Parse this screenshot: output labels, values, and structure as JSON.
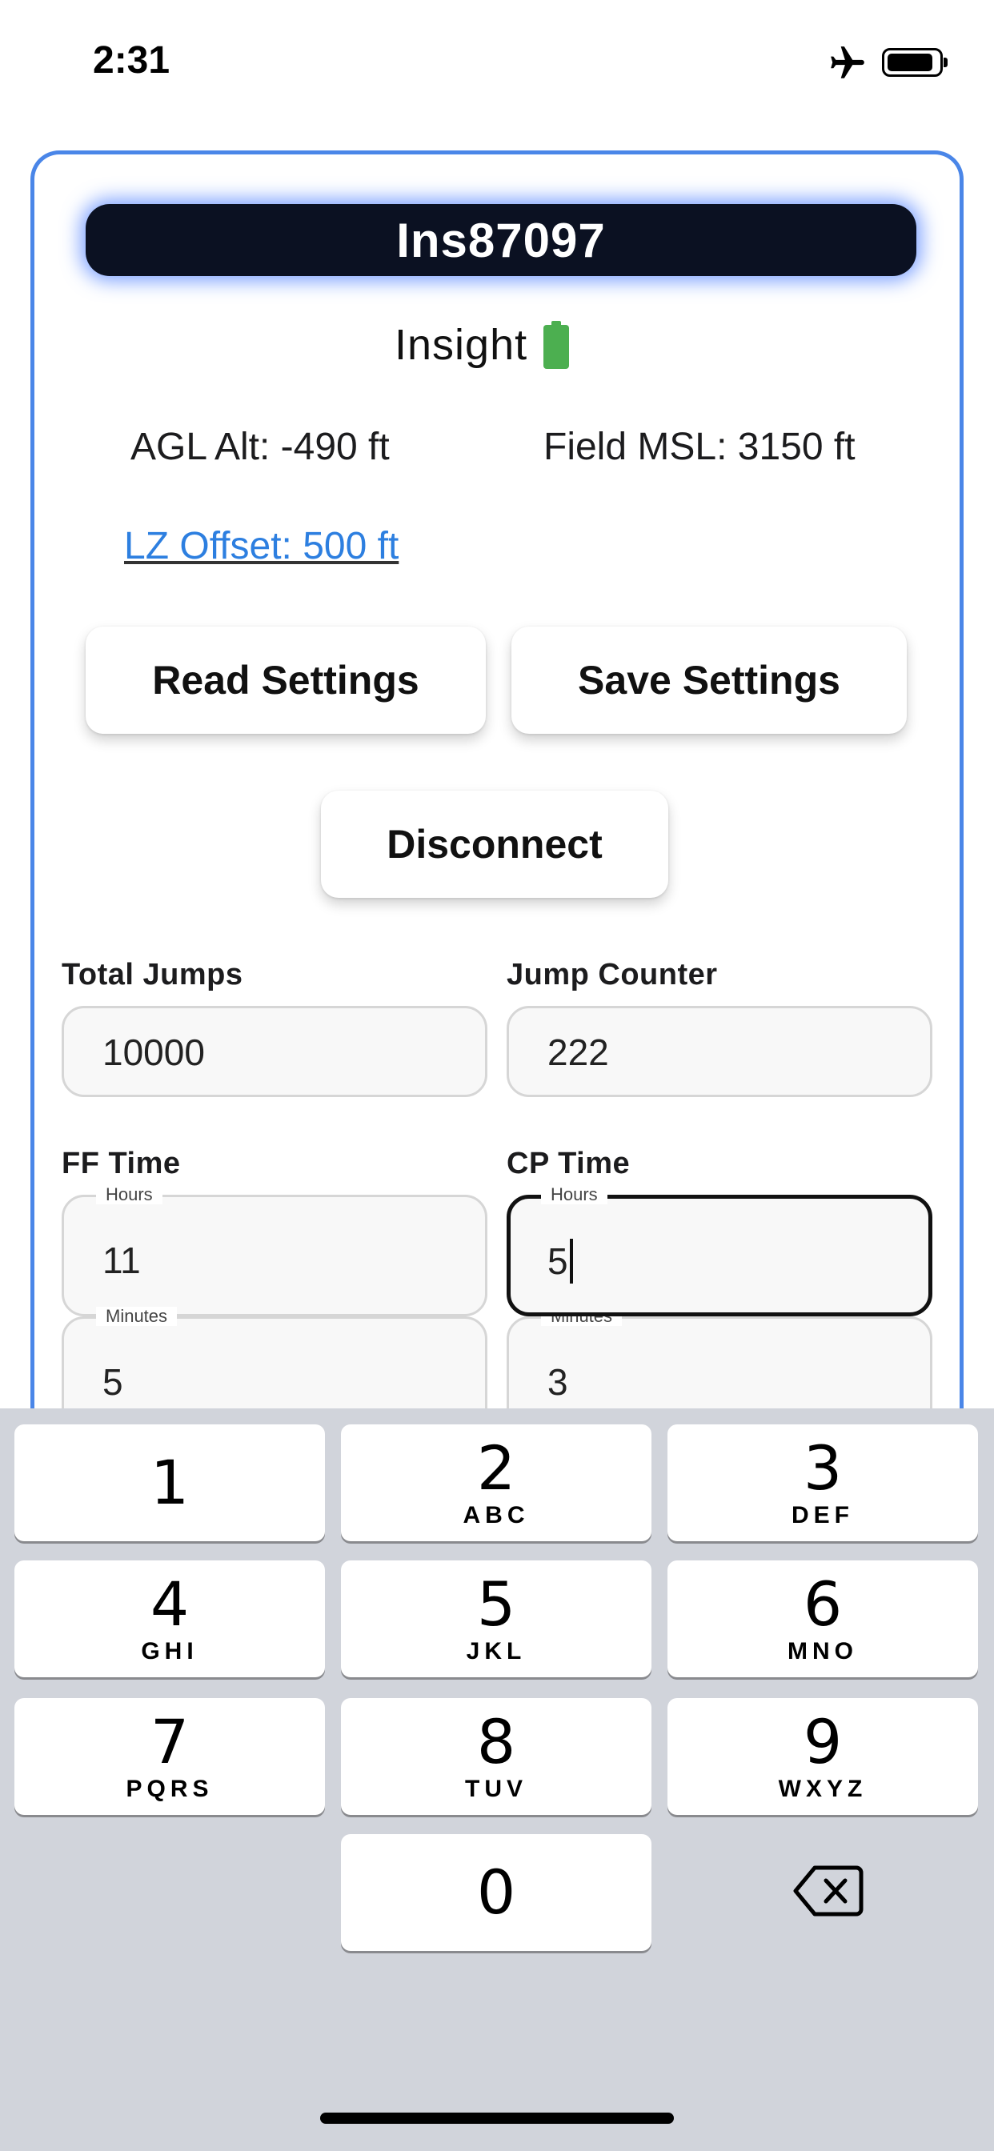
{
  "status_bar": {
    "time": "2:31",
    "airplane_icon": "airplane-icon",
    "battery_icon": "battery-icon"
  },
  "device": {
    "name": "Ins87097",
    "brand": "Insight",
    "battery_color": "#4caf50"
  },
  "readouts": {
    "agl_alt": "AGL Alt: -490 ft",
    "field_msl": "Field MSL: 3150 ft",
    "lz_offset": "LZ Offset: 500 ft"
  },
  "buttons": {
    "read_settings": "Read Settings",
    "save_settings": "Save Settings",
    "disconnect": "Disconnect"
  },
  "form": {
    "total_jumps": {
      "label": "Total Jumps",
      "value": "10000"
    },
    "jump_counter": {
      "label": "Jump Counter",
      "value": "222"
    },
    "ff_time": {
      "label": "FF Time",
      "hours_label": "Hours",
      "hours": "11",
      "minutes_label": "Minutes",
      "minutes": "5"
    },
    "cp_time": {
      "label": "CP Time",
      "hours_label": "Hours",
      "hours": "5",
      "minutes_label": "Minutes",
      "minutes": "3"
    }
  },
  "keyboard": {
    "keys": [
      {
        "num": "1",
        "letters": ""
      },
      {
        "num": "2",
        "letters": "ABC"
      },
      {
        "num": "3",
        "letters": "DEF"
      },
      {
        "num": "4",
        "letters": "GHI"
      },
      {
        "num": "5",
        "letters": "JKL"
      },
      {
        "num": "6",
        "letters": "MNO"
      },
      {
        "num": "7",
        "letters": "PQRS"
      },
      {
        "num": "8",
        "letters": "TUV"
      },
      {
        "num": "9",
        "letters": "WXYZ"
      },
      {
        "num": "0",
        "letters": ""
      }
    ],
    "delete_icon": "backspace-icon"
  },
  "colors": {
    "accent": "#4a86e8",
    "link": "#2d7fe0",
    "pill_bg": "#0b1122"
  }
}
